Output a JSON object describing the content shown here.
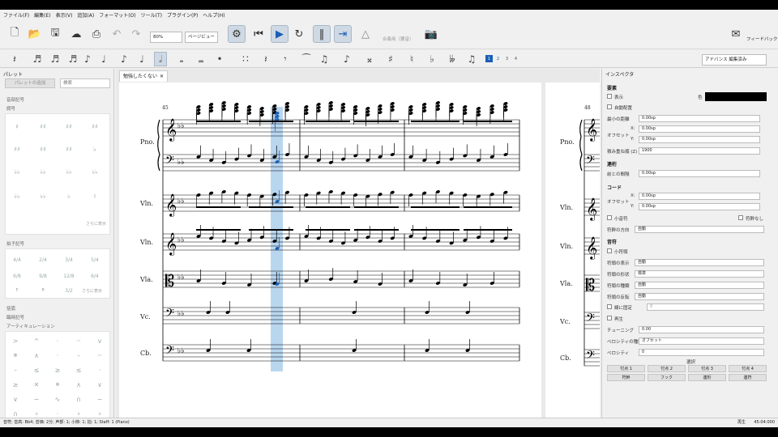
{
  "menubar": [
    "ファイル(F)",
    "編集(E)",
    "表示(V)",
    "追加(A)",
    "フォーマット(O)",
    "ツール(T)",
    "プラグイン(P)",
    "ヘルプ(H)"
  ],
  "toolbar": {
    "zoom": "80%",
    "view_mode": "ページビュー",
    "playback_hint": "合奏用（要音）",
    "feedback": "フィードバック"
  },
  "note_toolbar": {
    "voices": [
      "1",
      "2",
      "3",
      "4"
    ],
    "workspace": "アドバンス 編集済み"
  },
  "palette": {
    "title": "パレット",
    "add_button": "パレットの追加",
    "search_placeholder": "検索",
    "sections": [
      {
        "label": "音部記号"
      },
      {
        "label": "調号"
      },
      {
        "label": "拍子記号"
      },
      {
        "label": "括弧"
      },
      {
        "label": "臨時記号"
      },
      {
        "label": "アーティキュレーション"
      }
    ],
    "more_label": "さらに表示",
    "more_label2": "さらに表示"
  },
  "score": {
    "tab_title": "勉強したくない",
    "measure_start": "45",
    "measure_next": "48",
    "instruments": [
      "Pno.",
      "Vln.",
      "Vln.",
      "Vla.",
      "Vc.",
      "Cb."
    ],
    "next_page_instruments": [
      "Pno.",
      "Vln.",
      "Vln.",
      "Vla.",
      "Vc.",
      "Cb."
    ]
  },
  "inspector": {
    "title": "インスペクタ",
    "sections": {
      "element": "要素",
      "beam": "連桁",
      "chord": "コード",
      "note": "音符",
      "select": "選択"
    },
    "labels": {
      "visible": "表示",
      "color": "色",
      "auto_place": "自動配置",
      "min_distance": "最小の距離",
      "offset": "オフセット",
      "x": "X:",
      "y": "Y:",
      "stack_order": "積み重ね順 (Z)",
      "space_before": "前との間隔",
      "chord_offset": "オフセット",
      "small_note": "小音符",
      "no_stem": "符幹なし",
      "stem_direction": "符幹の方向",
      "small_notehead": "小符頭",
      "head_visible": "符頭の表示",
      "head_shape": "符頭の形状",
      "head_type": "符頭の種類",
      "head_flip": "符頭の反転",
      "fix_line": "線に固定",
      "play": "再生",
      "tuning": "チューニング",
      "velocity_type": "ベロシティの種類",
      "velocity": "ベロシティ"
    },
    "values": {
      "color_value": "#000000",
      "min_distance": "0.00sp",
      "offset_x": "0.00sp",
      "offset_y": "0.00sp",
      "stack_order": "1900",
      "space_before": "0.00sp",
      "chord_x": "0.00sp",
      "chord_y": "0.00sp",
      "stem_direction": "自動",
      "head_visible": "自動",
      "head_shape": "標準",
      "head_type": "自動",
      "head_flip": "自動",
      "fix_line": "0",
      "tuning": "0.00",
      "velocity_type": "オフセット",
      "velocity": "0"
    },
    "attach_buttons": [
      "付点 1",
      "付点 2",
      "付点 3",
      "付点 4"
    ],
    "select_buttons": [
      "符幹",
      "フック",
      "連桁",
      "連符"
    ]
  },
  "statusbar": {
    "info": "音符; 音高: Bb4; 音価: 2分; 声部: 1; 小節: 1; 拍: 1; Staff: 1 (Piano)",
    "mode": "再生",
    "time": "45:04:000"
  },
  "colors": {
    "accent": "#1a5fb4",
    "selection": "#b9d6ef"
  }
}
